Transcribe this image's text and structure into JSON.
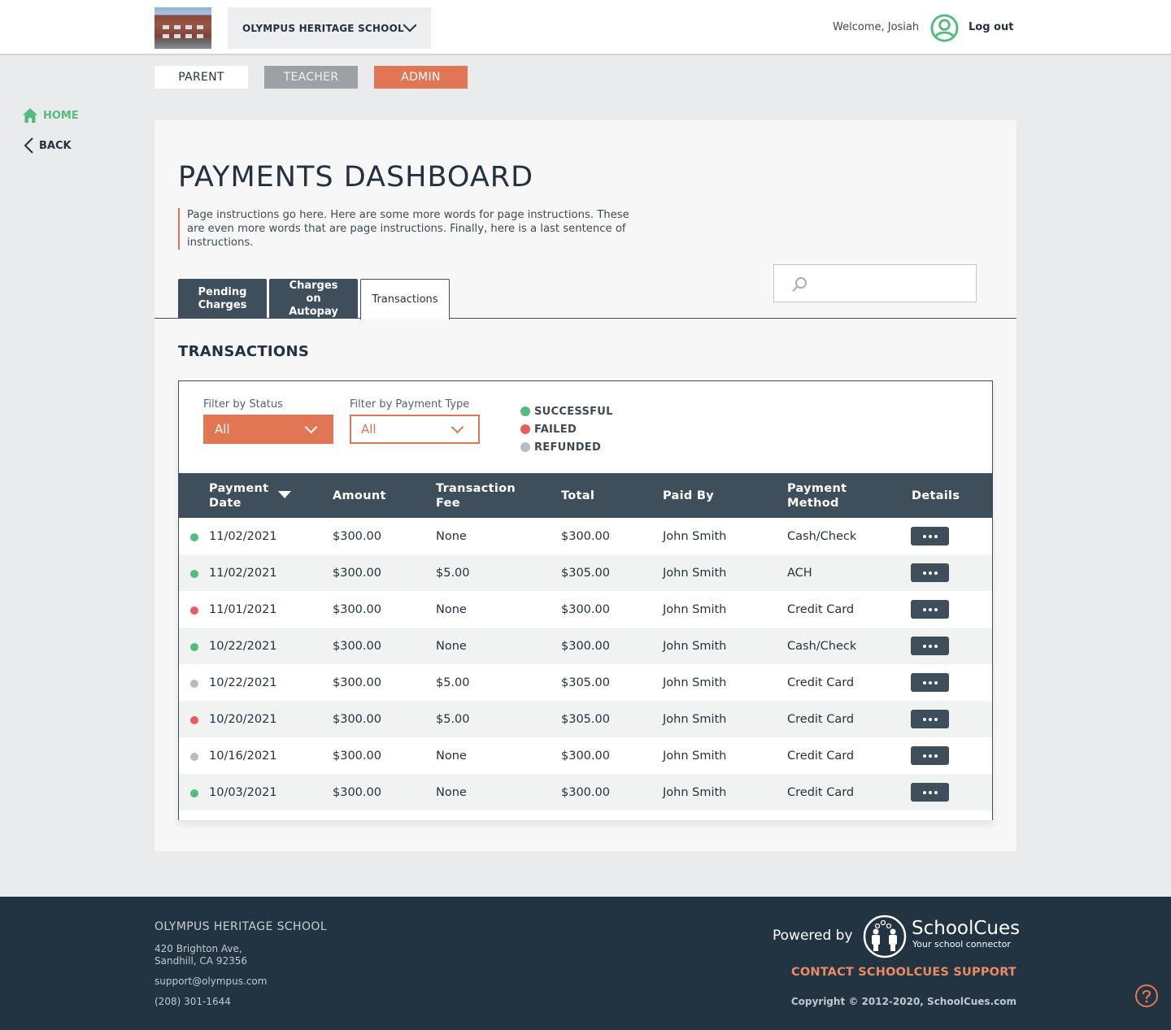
{
  "header": {
    "school_name": "OLYMPUS HERITAGE SCHOOL",
    "welcome": "Welcome, Josiah",
    "logout": "Log out"
  },
  "roles": [
    {
      "label": "PARENT",
      "active": true
    },
    {
      "label": "TEACHER",
      "active": false
    },
    {
      "label": "ADMIN",
      "active": false
    }
  ],
  "side_nav": {
    "home": "HOME",
    "back": "BACK"
  },
  "page": {
    "title": "PAYMENTS DASHBOARD",
    "instructions": "Page instructions go here. Here are some more words for page instructions. These are even more words that are page instructions. Finally, here is a last sentence of instructions.",
    "search_placeholder": "",
    "tabs": [
      {
        "label": "Pending Charges",
        "active": false
      },
      {
        "label": "Charges on Autopay",
        "active": false
      },
      {
        "label": "Transactions",
        "active": true
      }
    ],
    "section_title": "TRANSACTIONS"
  },
  "filters": {
    "status": {
      "label": "Filter by Status",
      "value": "All"
    },
    "payment_type": {
      "label": "Filter by Payment Type",
      "value": "All"
    }
  },
  "legend": [
    {
      "label": "SUCCESSFUL",
      "status": "successful",
      "color": "#55bb7d"
    },
    {
      "label": "FAILED",
      "status": "failed",
      "color": "#e85d5d"
    },
    {
      "label": "REFUNDED",
      "status": "refunded",
      "color": "#b8bcbf"
    }
  ],
  "status_colors": {
    "successful": "#55bb7d",
    "failed": "#e85d5d",
    "refunded": "#b8bcbf"
  },
  "table": {
    "columns": [
      "Payment Date",
      "Amount",
      "Transaction Fee",
      "Total",
      "Paid By",
      "Payment Method",
      "Details"
    ],
    "sort_column": "Payment Date",
    "sort_direction": "descending",
    "rows": [
      {
        "status": "successful",
        "date": "11/02/2021",
        "amount": "$300.00",
        "fee": "None",
        "total": "$300.00",
        "paid_by": "John Smith",
        "method": "Cash/Check"
      },
      {
        "status": "successful",
        "date": "11/02/2021",
        "amount": "$300.00",
        "fee": "$5.00",
        "total": "$305.00",
        "paid_by": "John Smith",
        "method": "ACH"
      },
      {
        "status": "failed",
        "date": "11/01/2021",
        "amount": "$300.00",
        "fee": "None",
        "total": "$300.00",
        "paid_by": "John Smith",
        "method": "Credit Card"
      },
      {
        "status": "successful",
        "date": "10/22/2021",
        "amount": "$300.00",
        "fee": "None",
        "total": "$300.00",
        "paid_by": "John Smith",
        "method": "Cash/Check"
      },
      {
        "status": "refunded",
        "date": "10/22/2021",
        "amount": "$300.00",
        "fee": "$5.00",
        "total": "$305.00",
        "paid_by": "John Smith",
        "method": "Credit Card"
      },
      {
        "status": "failed",
        "date": "10/20/2021",
        "amount": "$300.00",
        "fee": "$5.00",
        "total": "$305.00",
        "paid_by": "John Smith",
        "method": "Credit Card"
      },
      {
        "status": "refunded",
        "date": "10/16/2021",
        "amount": "$300.00",
        "fee": "None",
        "total": "$300.00",
        "paid_by": "John Smith",
        "method": "Credit Card"
      },
      {
        "status": "successful",
        "date": "10/03/2021",
        "amount": "$300.00",
        "fee": "None",
        "total": "$300.00",
        "paid_by": "John Smith",
        "method": "Credit Card"
      }
    ]
  },
  "footer": {
    "school_name": "OLYMPUS HERITAGE SCHOOL",
    "address_line1": "420 Brighton Ave,",
    "address_line2": "Sandhill, CA 92356",
    "email": "support@olympus.com",
    "phone": "(208) 301-1644",
    "powered_by": "Powered by",
    "brand_name": "SchoolCues",
    "brand_tagline": "Your school connector",
    "contact_support": "CONTACT SCHOOLCUES SUPPORT",
    "copyright": "Copyright © 2012-2020, SchoolCues.com"
  },
  "colors": {
    "accent": "#e07654",
    "dark": "#3e4e5a",
    "green": "#55bb7d",
    "footer_bg": "#223341"
  }
}
